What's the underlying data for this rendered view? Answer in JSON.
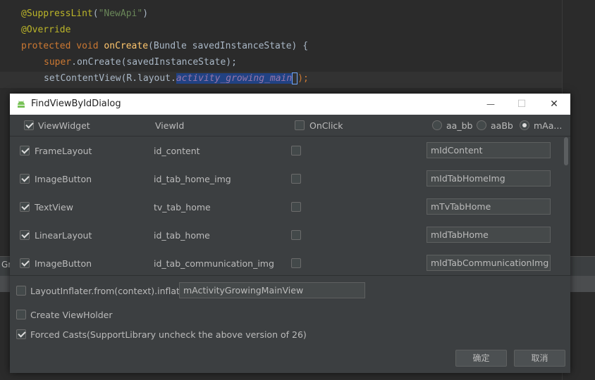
{
  "editor": {
    "line1": {
      "annotation": "@SuppressLint",
      "paren_open": "(",
      "string": "\"NewApi\"",
      "paren_close": ")"
    },
    "line2": {
      "annotation": "@Override"
    },
    "line3": {
      "kw1": "protected",
      "kw2": "void",
      "method": "onCreate",
      "rest": "(Bundle savedInstanceState) {"
    },
    "line4": {
      "kw": "super",
      "rest": ".onCreate(savedInstanceState);"
    },
    "line5": {
      "prefix": "setContentView(R.layout.",
      "selected": "activity_growing_main",
      "suffix": ");"
    },
    "bottom_label": "Gr"
  },
  "dialog": {
    "title": "FindViewByIdDialog",
    "window_buttons": {
      "minimize": "—",
      "maximize": "☐",
      "close": "✕"
    },
    "header": {
      "view_widget_label": "ViewWidget",
      "view_widget_checked": true,
      "view_id_label": "ViewId",
      "onclick_label": "OnClick",
      "onclick_checked": false,
      "naming_options": [
        {
          "label": "aa_bb",
          "selected": false
        },
        {
          "label": "aaBb",
          "selected": false
        },
        {
          "label": "mAa...",
          "selected": true
        }
      ]
    },
    "rows": [
      {
        "checked": true,
        "widget": "FrameLayout",
        "id": "id_content",
        "onclick": false,
        "field_name": "mIdContent"
      },
      {
        "checked": true,
        "widget": "ImageButton",
        "id": "id_tab_home_img",
        "onclick": false,
        "field_name": "mIdTabHomeImg"
      },
      {
        "checked": true,
        "widget": "TextView",
        "id": "tv_tab_home",
        "onclick": false,
        "field_name": "mTvTabHome"
      },
      {
        "checked": true,
        "widget": "LinearLayout",
        "id": "id_tab_home",
        "onclick": false,
        "field_name": "mIdTabHome"
      },
      {
        "checked": true,
        "widget": "ImageButton",
        "id": "id_tab_communication_img",
        "onclick": false,
        "field_name": "mIdTabCommunicationImg"
      }
    ],
    "options": {
      "layout_inflater_label": "LayoutInflater.from(context).inflater",
      "layout_inflater_checked": false,
      "layout_inflater_value": "mActivityGrowingMainView",
      "view_holder_label": "Create ViewHolder",
      "view_holder_checked": false,
      "forced_casts_label": "Forced Casts(SupportLibrary uncheck the above version of 26)",
      "forced_casts_checked": true
    },
    "buttons": {
      "ok": "确定",
      "cancel": "取消"
    }
  },
  "colors": {
    "editor_bg": "#2b2b2b",
    "dialog_bg": "#3c3f41",
    "annotation": "#bbb529",
    "keyword": "#cc7832",
    "string": "#6a8759",
    "method": "#ffc66d",
    "selection": "#214283"
  }
}
